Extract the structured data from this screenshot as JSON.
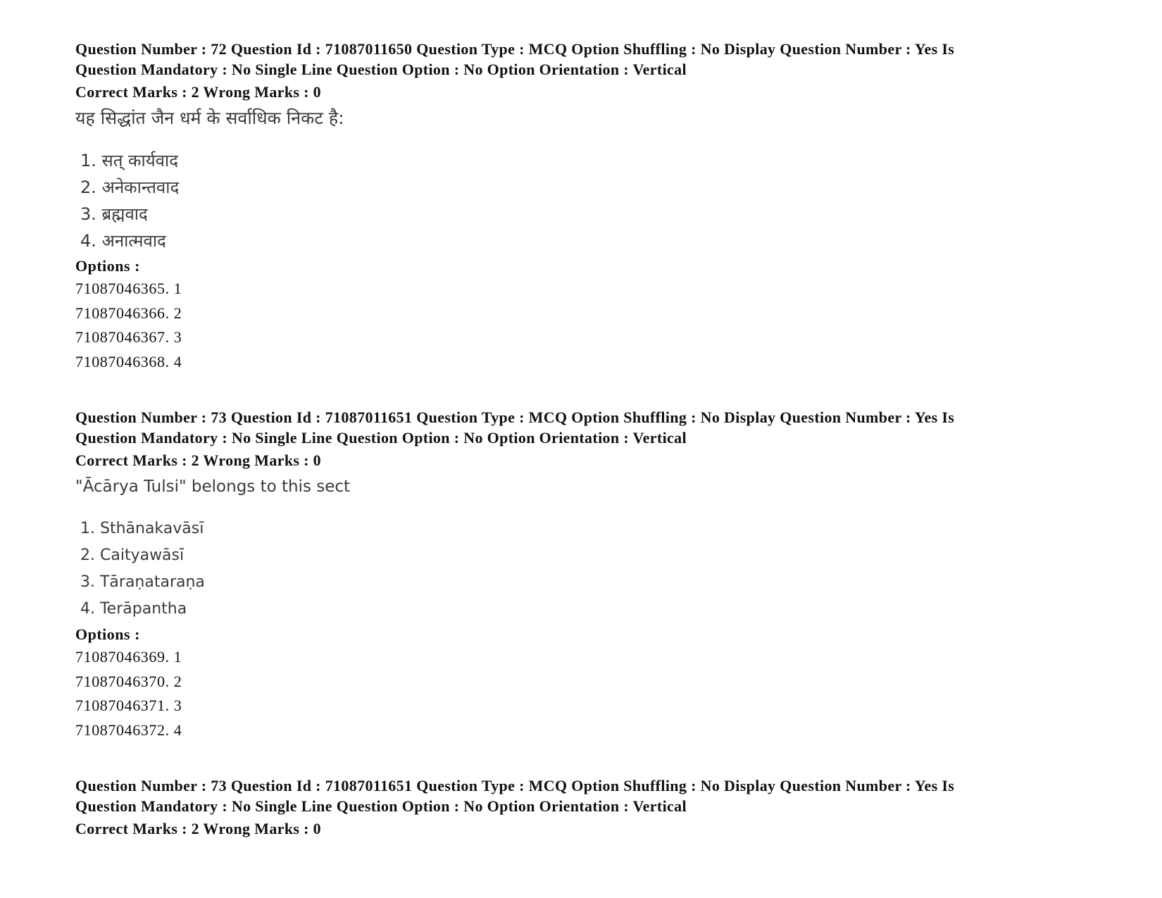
{
  "questions": [
    {
      "meta_line1": "Question Number : 72 Question Id : 71087011650 Question Type : MCQ Option Shuffling : No Display Question Number : Yes Is",
      "meta_line2": "Question Mandatory : No Single Line Question Option : No Option Orientation : Vertical",
      "marks": "Correct Marks : 2 Wrong Marks : 0",
      "text": "यह सिद्धांत जैन धर्म के सर्वाधिक निकट है:",
      "choices": [
        "1. सत् कार्यवाद",
        "2. अनेकान्तवाद",
        "3. ब्रह्मवाद",
        "4. अनात्मवाद"
      ],
      "options_label": "Options :",
      "options": [
        "71087046365. 1",
        "71087046366. 2",
        "71087046367. 3",
        "71087046368. 4"
      ]
    },
    {
      "meta_line1": "Question Number : 73 Question Id : 71087011651 Question Type : MCQ Option Shuffling : No Display Question Number : Yes Is",
      "meta_line2": "Question Mandatory : No Single Line Question Option : No Option Orientation : Vertical",
      "marks": "Correct Marks : 2 Wrong Marks : 0",
      "text": "\"Ācārya Tulsi\" belongs to this sect",
      "choices": [
        "1. Sthānakavāsī",
        "2. Caityawāsī",
        "3. Tāraṇataraṇa",
        "4. Terāpantha"
      ],
      "options_label": "Options :",
      "options": [
        "71087046369. 1",
        "71087046370. 2",
        "71087046371. 3",
        "71087046372. 4"
      ]
    },
    {
      "meta_line1": "Question Number : 73 Question Id : 71087011651 Question Type : MCQ Option Shuffling : No Display Question Number : Yes Is",
      "meta_line2": "Question Mandatory : No Single Line Question Option : No Option Orientation : Vertical",
      "marks": "Correct Marks : 2 Wrong Marks : 0"
    }
  ]
}
